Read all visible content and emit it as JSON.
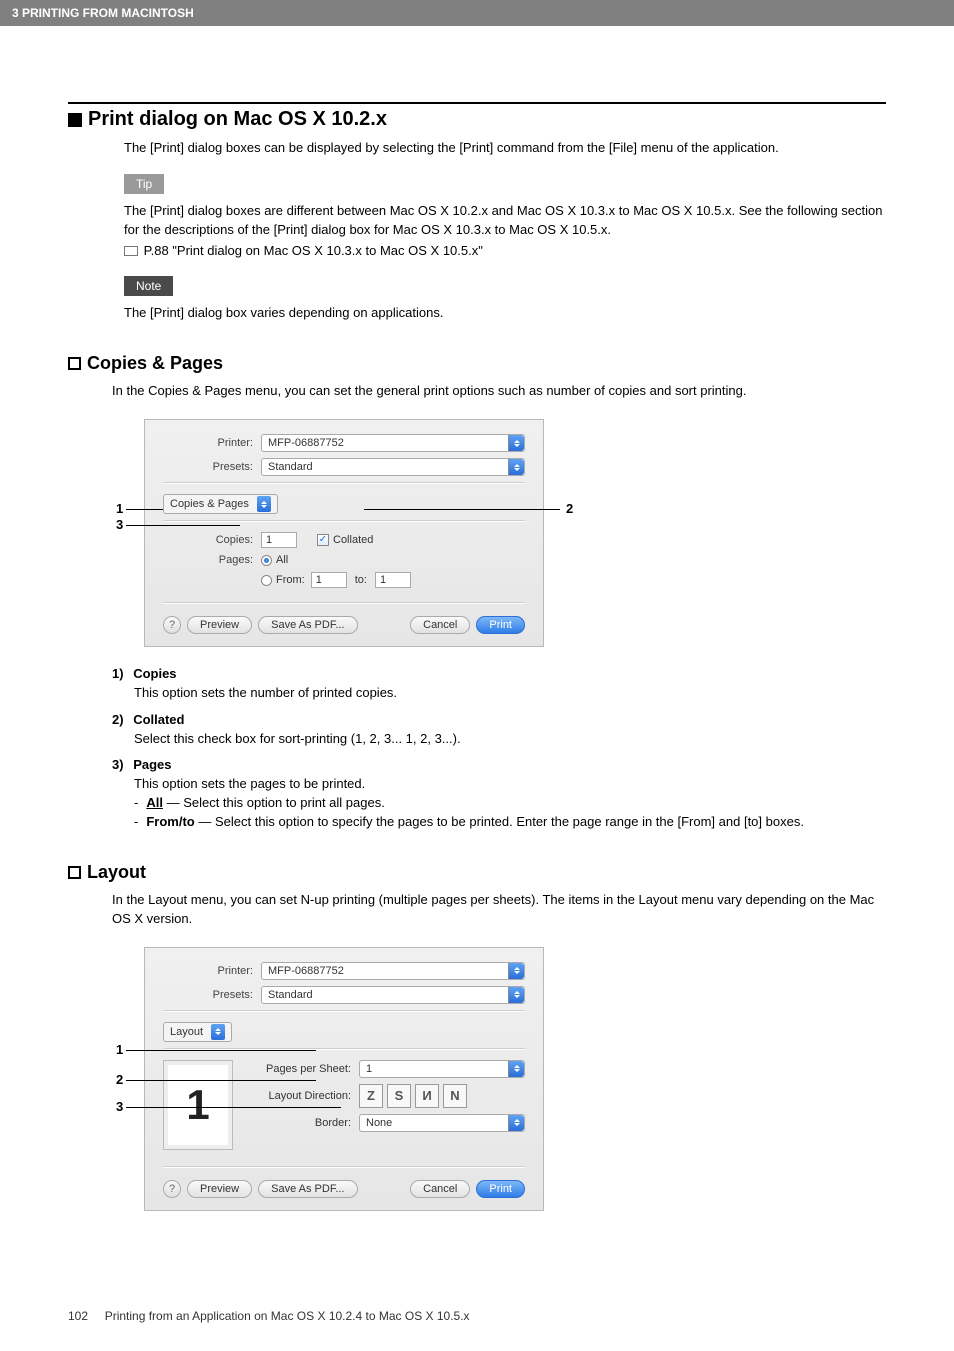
{
  "header": {
    "chapter": "3 PRINTING FROM MACINTOSH"
  },
  "section": {
    "title": "Print dialog on Mac OS X 10.2.x",
    "intro": "The [Print] dialog boxes can be displayed by selecting the [Print] command from the [File] menu of the application."
  },
  "tip": {
    "label": "Tip",
    "text1": "The [Print] dialog boxes are different between Mac OS X 10.2.x and Mac OS X 10.3.x to Mac OS X 10.5.x. See the following section for the descriptions of the [Print] dialog box for Mac OS X 10.3.x to Mac OS X 10.5.x.",
    "ref": "P.88 \"Print dialog on Mac OS X 10.3.x to Mac OS X 10.5.x\""
  },
  "note": {
    "label": "Note",
    "text": "The [Print] dialog box varies depending on applications."
  },
  "copies_pages": {
    "heading": "Copies & Pages",
    "intro": "In the Copies & Pages menu, you can set the general print options such as number of copies and sort printing.",
    "dialog": {
      "printer_label": "Printer:",
      "printer_value": "MFP-06887752",
      "presets_label": "Presets:",
      "presets_value": "Standard",
      "tab": "Copies & Pages",
      "copies_label": "Copies:",
      "copies_value": "1",
      "collated_label": "Collated",
      "pages_label": "Pages:",
      "all_label": "All",
      "from_label": "From:",
      "from_value": "1",
      "to_label": "to:",
      "to_value": "1",
      "help": "?",
      "preview": "Preview",
      "save_pdf": "Save As PDF...",
      "cancel": "Cancel",
      "print": "Print"
    },
    "callouts": {
      "c1": "1",
      "c2": "2",
      "c3": "3"
    },
    "items": {
      "i1_num": "1)",
      "i1_title": "Copies",
      "i1_desc": "This option sets the number of printed copies.",
      "i2_num": "2)",
      "i2_title": "Collated",
      "i2_desc": "Select this check box for sort-printing (1, 2, 3... 1, 2, 3...).",
      "i3_num": "3)",
      "i3_title": "Pages",
      "i3_desc": "This option sets the pages to be printed.",
      "i3a_label": "All",
      "i3a_desc": " — Select this option to print all pages.",
      "i3b_label": "From/to",
      "i3b_desc": " — Select this option to specify the pages to be printed. Enter the page range in the [From] and [to] boxes."
    }
  },
  "layout": {
    "heading": "Layout",
    "intro": "In the Layout menu, you can set N-up printing (multiple pages per sheets). The items in the Layout menu vary depending on the Mac OS X version.",
    "dialog": {
      "printer_label": "Printer:",
      "printer_value": "MFP-06887752",
      "presets_label": "Presets:",
      "presets_value": "Standard",
      "tab": "Layout",
      "pps_label": "Pages per Sheet:",
      "pps_value": "1",
      "dir_label": "Layout Direction:",
      "border_label": "Border:",
      "border_value": "None",
      "preview_digit": "1",
      "help": "?",
      "preview": "Preview",
      "save_pdf": "Save As PDF...",
      "cancel": "Cancel",
      "print": "Print"
    },
    "callouts": {
      "c1": "1",
      "c2": "2",
      "c3": "3"
    }
  },
  "footer": {
    "page": "102",
    "text": "Printing from an Application on Mac OS X 10.2.4 to Mac OS X 10.5.x"
  }
}
